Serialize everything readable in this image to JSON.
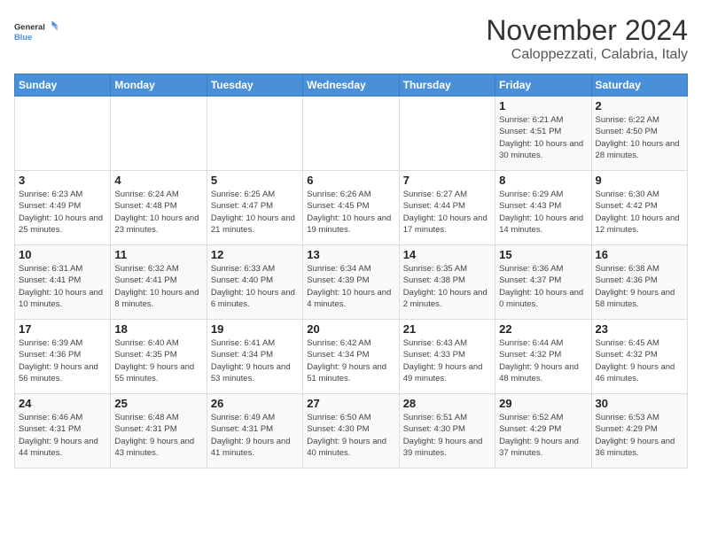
{
  "logo": {
    "text_general": "General",
    "text_blue": "Blue"
  },
  "title": "November 2024",
  "subtitle": "Caloppezzati, Calabria, Italy",
  "weekdays": [
    "Sunday",
    "Monday",
    "Tuesday",
    "Wednesday",
    "Thursday",
    "Friday",
    "Saturday"
  ],
  "weeks": [
    [
      {
        "day": "",
        "info": ""
      },
      {
        "day": "",
        "info": ""
      },
      {
        "day": "",
        "info": ""
      },
      {
        "day": "",
        "info": ""
      },
      {
        "day": "",
        "info": ""
      },
      {
        "day": "1",
        "info": "Sunrise: 6:21 AM\nSunset: 4:51 PM\nDaylight: 10 hours and 30 minutes."
      },
      {
        "day": "2",
        "info": "Sunrise: 6:22 AM\nSunset: 4:50 PM\nDaylight: 10 hours and 28 minutes."
      }
    ],
    [
      {
        "day": "3",
        "info": "Sunrise: 6:23 AM\nSunset: 4:49 PM\nDaylight: 10 hours and 25 minutes."
      },
      {
        "day": "4",
        "info": "Sunrise: 6:24 AM\nSunset: 4:48 PM\nDaylight: 10 hours and 23 minutes."
      },
      {
        "day": "5",
        "info": "Sunrise: 6:25 AM\nSunset: 4:47 PM\nDaylight: 10 hours and 21 minutes."
      },
      {
        "day": "6",
        "info": "Sunrise: 6:26 AM\nSunset: 4:45 PM\nDaylight: 10 hours and 19 minutes."
      },
      {
        "day": "7",
        "info": "Sunrise: 6:27 AM\nSunset: 4:44 PM\nDaylight: 10 hours and 17 minutes."
      },
      {
        "day": "8",
        "info": "Sunrise: 6:29 AM\nSunset: 4:43 PM\nDaylight: 10 hours and 14 minutes."
      },
      {
        "day": "9",
        "info": "Sunrise: 6:30 AM\nSunset: 4:42 PM\nDaylight: 10 hours and 12 minutes."
      }
    ],
    [
      {
        "day": "10",
        "info": "Sunrise: 6:31 AM\nSunset: 4:41 PM\nDaylight: 10 hours and 10 minutes."
      },
      {
        "day": "11",
        "info": "Sunrise: 6:32 AM\nSunset: 4:41 PM\nDaylight: 10 hours and 8 minutes."
      },
      {
        "day": "12",
        "info": "Sunrise: 6:33 AM\nSunset: 4:40 PM\nDaylight: 10 hours and 6 minutes."
      },
      {
        "day": "13",
        "info": "Sunrise: 6:34 AM\nSunset: 4:39 PM\nDaylight: 10 hours and 4 minutes."
      },
      {
        "day": "14",
        "info": "Sunrise: 6:35 AM\nSunset: 4:38 PM\nDaylight: 10 hours and 2 minutes."
      },
      {
        "day": "15",
        "info": "Sunrise: 6:36 AM\nSunset: 4:37 PM\nDaylight: 10 hours and 0 minutes."
      },
      {
        "day": "16",
        "info": "Sunrise: 6:38 AM\nSunset: 4:36 PM\nDaylight: 9 hours and 58 minutes."
      }
    ],
    [
      {
        "day": "17",
        "info": "Sunrise: 6:39 AM\nSunset: 4:36 PM\nDaylight: 9 hours and 56 minutes."
      },
      {
        "day": "18",
        "info": "Sunrise: 6:40 AM\nSunset: 4:35 PM\nDaylight: 9 hours and 55 minutes."
      },
      {
        "day": "19",
        "info": "Sunrise: 6:41 AM\nSunset: 4:34 PM\nDaylight: 9 hours and 53 minutes."
      },
      {
        "day": "20",
        "info": "Sunrise: 6:42 AM\nSunset: 4:34 PM\nDaylight: 9 hours and 51 minutes."
      },
      {
        "day": "21",
        "info": "Sunrise: 6:43 AM\nSunset: 4:33 PM\nDaylight: 9 hours and 49 minutes."
      },
      {
        "day": "22",
        "info": "Sunrise: 6:44 AM\nSunset: 4:32 PM\nDaylight: 9 hours and 48 minutes."
      },
      {
        "day": "23",
        "info": "Sunrise: 6:45 AM\nSunset: 4:32 PM\nDaylight: 9 hours and 46 minutes."
      }
    ],
    [
      {
        "day": "24",
        "info": "Sunrise: 6:46 AM\nSunset: 4:31 PM\nDaylight: 9 hours and 44 minutes."
      },
      {
        "day": "25",
        "info": "Sunrise: 6:48 AM\nSunset: 4:31 PM\nDaylight: 9 hours and 43 minutes."
      },
      {
        "day": "26",
        "info": "Sunrise: 6:49 AM\nSunset: 4:31 PM\nDaylight: 9 hours and 41 minutes."
      },
      {
        "day": "27",
        "info": "Sunrise: 6:50 AM\nSunset: 4:30 PM\nDaylight: 9 hours and 40 minutes."
      },
      {
        "day": "28",
        "info": "Sunrise: 6:51 AM\nSunset: 4:30 PM\nDaylight: 9 hours and 39 minutes."
      },
      {
        "day": "29",
        "info": "Sunrise: 6:52 AM\nSunset: 4:29 PM\nDaylight: 9 hours and 37 minutes."
      },
      {
        "day": "30",
        "info": "Sunrise: 6:53 AM\nSunset: 4:29 PM\nDaylight: 9 hours and 36 minutes."
      }
    ]
  ]
}
